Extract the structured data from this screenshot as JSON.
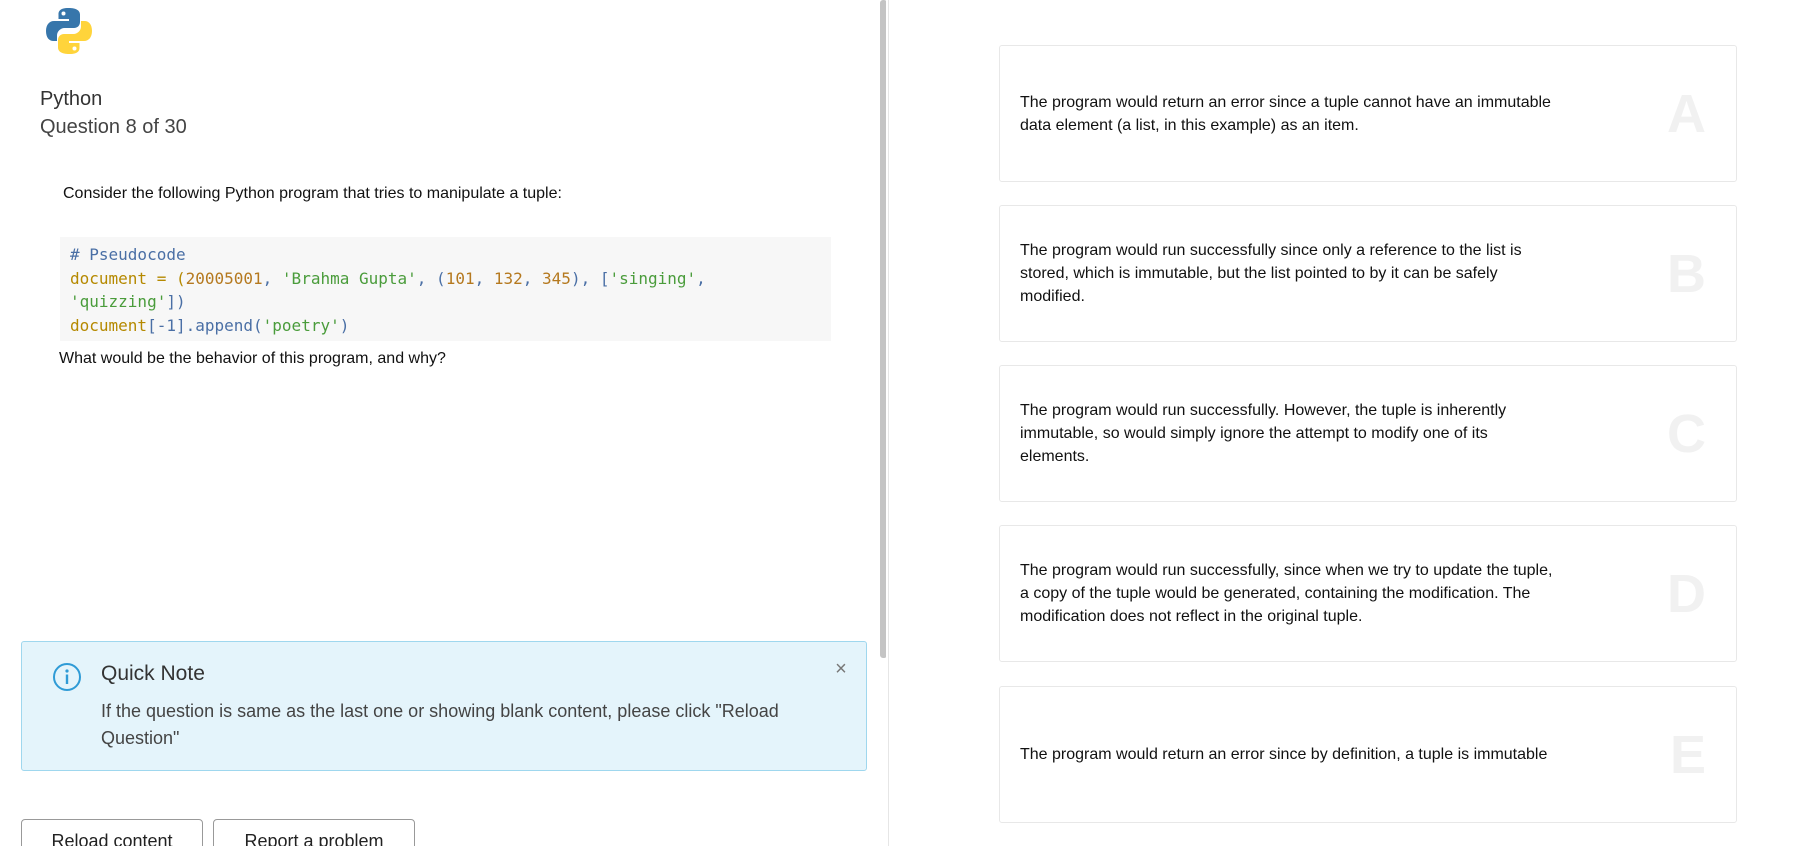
{
  "header": {
    "logo_icon": "python-logo-icon",
    "subject": "Python",
    "progress": "Question 8 of 30"
  },
  "question": {
    "intro": "Consider the following Python program that tries to manipulate a tuple:",
    "code": {
      "line1": "# Pseudocode",
      "var": "document",
      "eq": " = (",
      "num1": "20005001",
      "comma1": ", ",
      "str1": "'Brahma Gupta'",
      "comma2": ", (",
      "num2": "101",
      "comma3": ", ",
      "num3": "132",
      "comma4": ", ",
      "num4": "345",
      "close1": "), [",
      "str2": "'singing'",
      "comma5": ",",
      "str3": "'quizzing'",
      "close2": "])",
      "var2": "document",
      "index": "[-1]",
      "method": ".append(",
      "str4": "'poetry'",
      "close3": ")"
    },
    "prompt": "What would be the behavior of this program, and why?"
  },
  "note": {
    "icon": "info-icon",
    "title": "Quick Note",
    "text": "If the question is same as the last one or showing blank content, please click \"Reload Question\"",
    "close_label": "×"
  },
  "buttons": {
    "reload": "Reload content",
    "report": "Report a problem"
  },
  "options": [
    {
      "letter": "A",
      "text": "The program would return an error since a tuple cannot have an immutable data element (a list, in this example) as an item."
    },
    {
      "letter": "B",
      "text": "The program would run successfully since only a reference to the list is stored, which is immutable, but the list pointed to by it can be safely modified."
    },
    {
      "letter": "C",
      "text": "The program would run successfully. However, the tuple is inherently immutable, so would simply ignore the attempt to modify one of its elements."
    },
    {
      "letter": "D",
      "text": "The program would run successfully, since when we try to update the tuple, a copy of the tuple would be generated, containing the modification. The modification does not reflect in the original tuple."
    },
    {
      "letter": "E",
      "text": "The program would return an error since by definition, a tuple is immutable"
    }
  ],
  "colors": {
    "note_bg": "#e4f4fb",
    "note_border": "#9fd7ee",
    "info_blue": "#2f9bd6",
    "python_blue": "#3776ab",
    "python_yellow": "#ffd43b"
  }
}
